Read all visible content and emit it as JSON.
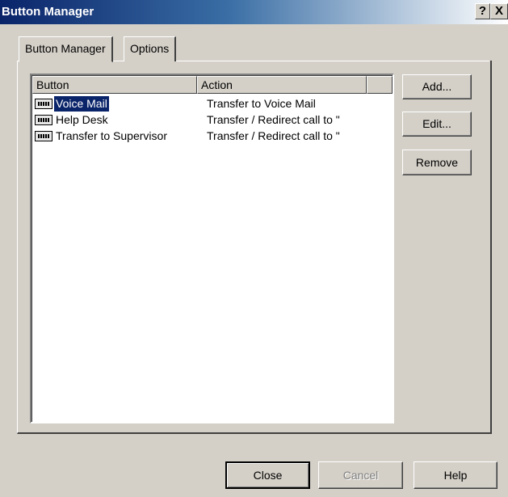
{
  "window": {
    "title": "Button Manager",
    "help_glyph": "?",
    "close_glyph": "X"
  },
  "tabs": [
    {
      "label": "Button Manager",
      "active": true
    },
    {
      "label": "Options",
      "active": false
    }
  ],
  "list": {
    "columns": [
      "Button",
      "Action"
    ],
    "rows": [
      {
        "name": "Voice Mail",
        "action": "Transfer to Voice Mail",
        "icon": "button-icon",
        "selected": true
      },
      {
        "name": "Help Desk",
        "action": "Transfer / Redirect call to \"",
        "icon": "button-icon",
        "selected": false
      },
      {
        "name": "Transfer to Supervisor",
        "action": "Transfer / Redirect call to \"",
        "icon": "button-icon",
        "selected": false
      }
    ]
  },
  "side_buttons": {
    "add": "Add...",
    "edit": "Edit...",
    "remove": "Remove"
  },
  "footer_buttons": {
    "close": "Close",
    "cancel": "Cancel",
    "help": "Help"
  },
  "colors": {
    "selection": "#0a246a",
    "title_gradient_start": "#0a246a",
    "face": "#d4d0c8"
  }
}
